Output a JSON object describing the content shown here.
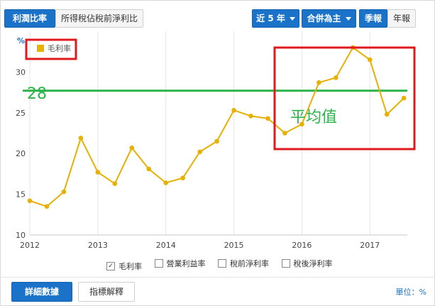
{
  "toolbar": {
    "tab_active": "利潤比率",
    "tab_other": "所得稅佔稅前淨利比",
    "range": "近 5 年",
    "mode": "合併為主",
    "period_active": "季報",
    "period_other": "年報"
  },
  "legend": {
    "label": "毛利率",
    "color": "#e8b000"
  },
  "checkboxes": [
    {
      "label": "毛利率",
      "checked": true,
      "mark": "✓"
    },
    {
      "label": "營業利益率",
      "checked": false,
      "mark": ""
    },
    {
      "label": "稅前淨利率",
      "checked": false,
      "mark": ""
    },
    {
      "label": "稅後淨利率",
      "checked": false,
      "mark": ""
    }
  ],
  "footer": {
    "detail_button": "詳細數據",
    "explain_button": "指標解釋",
    "unit": "單位：%"
  },
  "annotations": {
    "avg_value": "28",
    "avg_text": "平均值",
    "avg_color": "#2bb34a",
    "box_color": "#e0191f"
  },
  "chart_data": {
    "type": "line",
    "ylabel": "%",
    "ylim": [
      10,
      35
    ],
    "yticks": [
      10,
      15,
      20,
      25,
      30
    ],
    "xlim": [
      2012,
      2017.55
    ],
    "xticks": [
      "2012",
      "2013",
      "2014",
      "2015",
      "2016",
      "2017"
    ],
    "grid": "vertical",
    "legend_position": "top-left",
    "series": [
      {
        "name": "毛利率",
        "color": "#e8b000",
        "points": [
          [
            2012.0,
            14.2
          ],
          [
            2012.25,
            13.5
          ],
          [
            2012.5,
            15.3
          ],
          [
            2012.75,
            21.9
          ],
          [
            2013.0,
            17.7
          ],
          [
            2013.25,
            16.3
          ],
          [
            2013.5,
            20.7
          ],
          [
            2013.75,
            18.1
          ],
          [
            2014.0,
            16.4
          ],
          [
            2014.25,
            17.0
          ],
          [
            2014.5,
            20.2
          ],
          [
            2014.75,
            21.5
          ],
          [
            2015.0,
            25.3
          ],
          [
            2015.25,
            24.6
          ],
          [
            2015.5,
            24.3
          ],
          [
            2015.75,
            22.5
          ],
          [
            2016.0,
            23.6
          ],
          [
            2016.25,
            28.7
          ],
          [
            2016.5,
            29.3
          ],
          [
            2016.75,
            33.0
          ],
          [
            2017.0,
            31.5
          ],
          [
            2017.25,
            24.8
          ],
          [
            2017.5,
            26.8
          ]
        ]
      }
    ],
    "reference_line": {
      "value": 27.7
    }
  }
}
